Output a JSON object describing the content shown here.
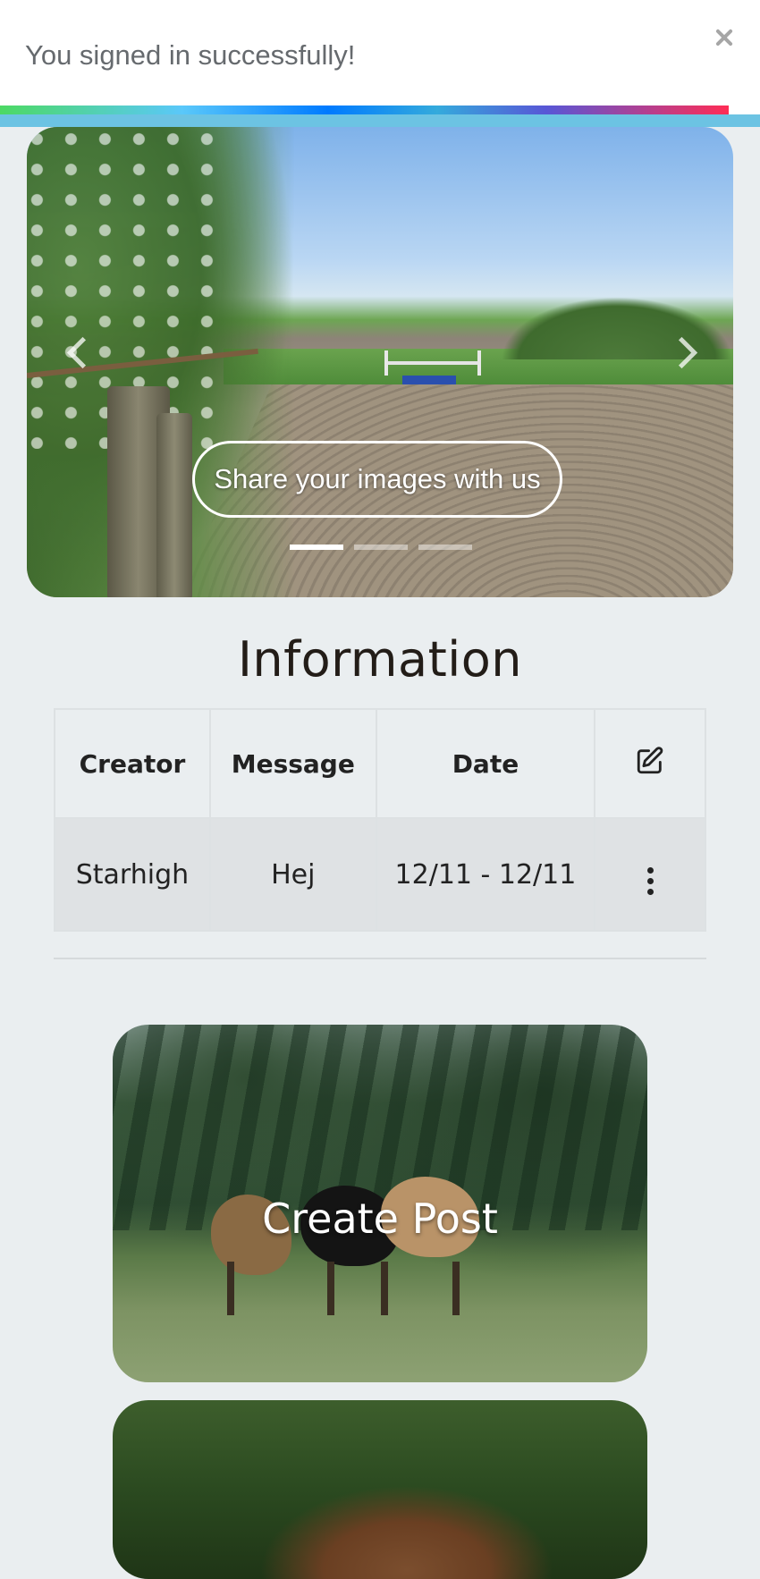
{
  "toast": {
    "message": "You signed in successfully!",
    "close_icon": "close-icon",
    "progress": 0.96
  },
  "carousel": {
    "caption": "Share your images with us",
    "slide_count": 3,
    "active_index": 0,
    "prev_icon": "chevron-left-icon",
    "next_icon": "chevron-right-icon"
  },
  "information": {
    "title": "Information",
    "columns": [
      "Creator",
      "Message",
      "Date"
    ],
    "edit_icon": "edit-icon",
    "rows": [
      {
        "creator": "Starhigh",
        "message": "Hej",
        "date": "12/11 - 12/11",
        "menu_icon": "more-vertical-icon"
      }
    ]
  },
  "cards": {
    "create_post_label": "Create Post"
  },
  "colors": {
    "background": "#eaeef0",
    "toast_bottom": "#6cc3e3",
    "row_background": "#dfe2e4"
  }
}
